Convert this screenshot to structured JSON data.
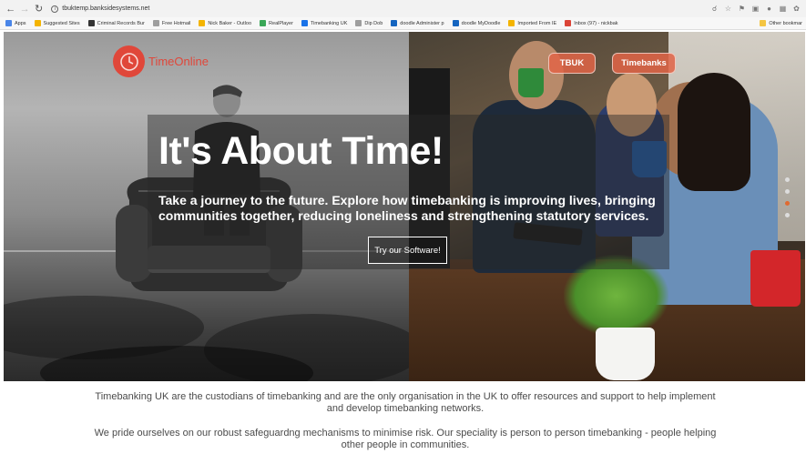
{
  "browser": {
    "url": "tbuktemp.banksidesystems.net",
    "bookmarks": [
      {
        "label": "Apps",
        "color": "#4a86e8"
      },
      {
        "label": "Suggested Sites",
        "color": "#f4b400"
      },
      {
        "label": "Criminal Records Bur",
        "color": "#333333"
      },
      {
        "label": "Free Hotmail",
        "color": "#9e9e9e"
      },
      {
        "label": "Nick Baker - Outloo",
        "color": "#f4b400"
      },
      {
        "label": "RealPlayer",
        "color": "#3aa757"
      },
      {
        "label": "Timebanking UK",
        "color": "#1a73e8"
      },
      {
        "label": "Dip Dob",
        "color": "#9e9e9e"
      },
      {
        "label": "doodle Administer p",
        "color": "#1565c0"
      },
      {
        "label": "doodle MyDoodle",
        "color": "#1565c0"
      },
      {
        "label": "Imported From IE",
        "color": "#f4b400"
      },
      {
        "label": "Inbox (97) - nickbak",
        "color": "#db4437"
      }
    ],
    "other_bookmarks": "Other bookmar"
  },
  "hero": {
    "logo_text": "TimeOnline",
    "nav": [
      "TBUK",
      "Timebanks"
    ],
    "headline": "It's About Time!",
    "subline": "Take a journey to the future. Explore how timebanking is improving lives, bringing communities together, reducing loneliness and strengthening statutory services.",
    "cta": "Try our Software!"
  },
  "intro": {
    "p1": "Timebanking UK are the custodians of timebanking and are the only organisation in the UK to offer resources and support to help implement and develop timebanking networks.",
    "p2": "We pride ourselves on our robust safeguardng mechanisms to minimise risk. Our speciality is person to person timebanking - people helping other people in communities."
  },
  "colors": {
    "accent": "#e0473a",
    "pill": "#e16446",
    "slider_active": "#e06a30"
  }
}
